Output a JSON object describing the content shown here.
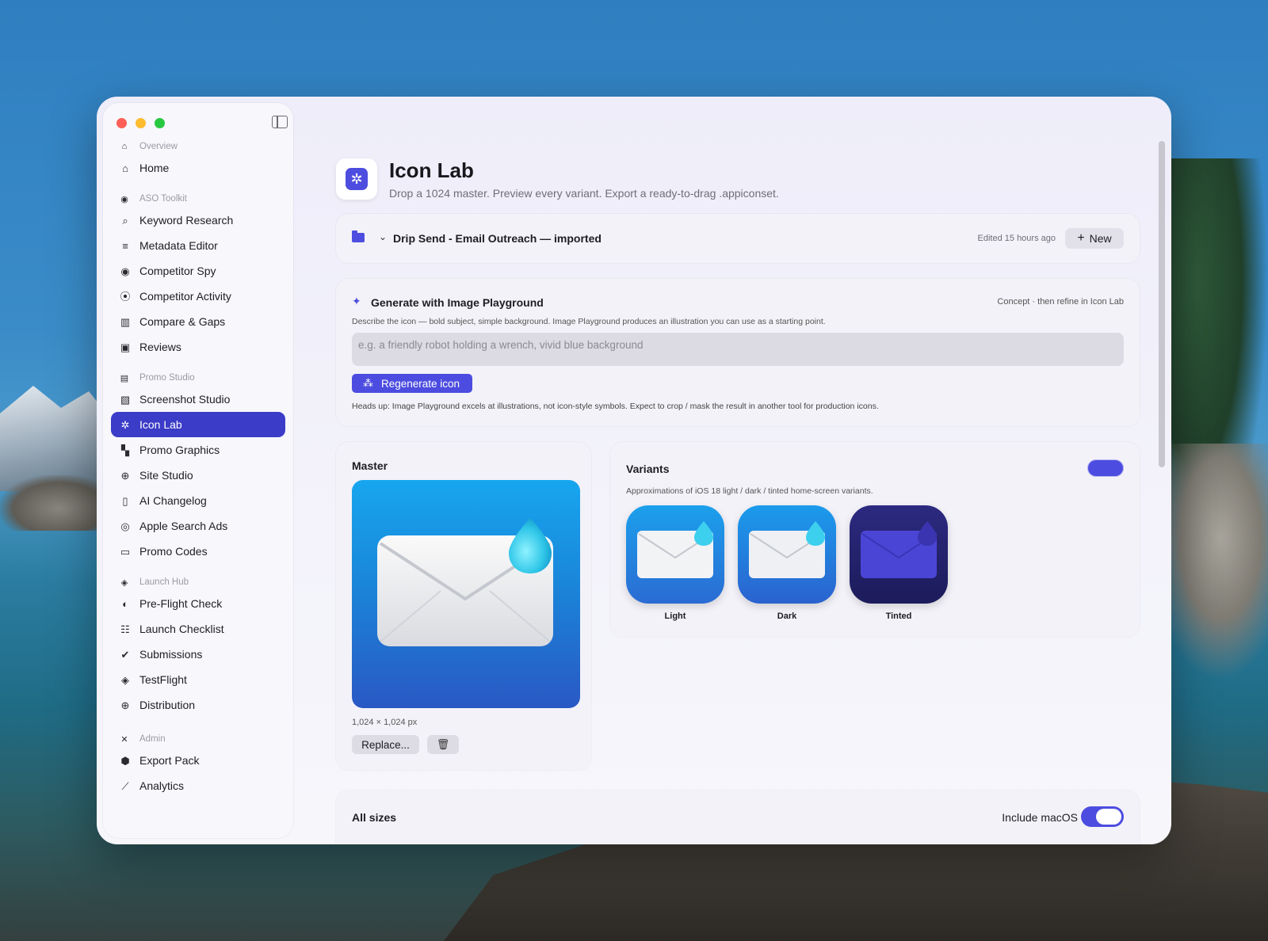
{
  "sidebar": {
    "sections": [
      {
        "header": "Overview",
        "header_icon": "house-icon",
        "items": [
          {
            "label": "Home",
            "icon": "house-icon"
          }
        ]
      },
      {
        "header": "ASO Toolkit",
        "header_icon": "magnifier-icon",
        "items": [
          {
            "label": "Keyword Research",
            "icon": "magnifier-icon"
          },
          {
            "label": "Metadata Editor",
            "icon": "text-lines-icon"
          },
          {
            "label": "Competitor Spy",
            "icon": "eye-icon"
          },
          {
            "label": "Competitor Activity",
            "icon": "broadcast-icon"
          },
          {
            "label": "Compare & Gaps",
            "icon": "columns-icon"
          },
          {
            "label": "Reviews",
            "icon": "speech-bubbles-icon"
          }
        ]
      },
      {
        "header": "Promo Studio",
        "header_icon": "bag-icon",
        "items": [
          {
            "label": "Screenshot Studio",
            "icon": "photo-icon"
          },
          {
            "label": "Icon Lab",
            "icon": "app-icon"
          },
          {
            "label": "Promo Graphics",
            "icon": "layout-icon"
          },
          {
            "label": "Site Studio",
            "icon": "globe-icon"
          },
          {
            "label": "AI Changelog",
            "icon": "document-icon"
          },
          {
            "label": "Apple Search Ads",
            "icon": "magnifier-circle-icon"
          },
          {
            "label": "Promo Codes",
            "icon": "ticket-icon"
          }
        ]
      },
      {
        "header": "Launch Hub",
        "header_icon": "paperplane-icon",
        "items": [
          {
            "label": "Pre-Flight Check",
            "icon": "gauge-icon"
          },
          {
            "label": "Launch Checklist",
            "icon": "checklist-icon"
          },
          {
            "label": "Submissions",
            "icon": "checkmark-seal-icon"
          },
          {
            "label": "TestFlight",
            "icon": "paperplane-icon"
          },
          {
            "label": "Distribution",
            "icon": "globe-icon"
          }
        ]
      },
      {
        "header": "Admin",
        "header_icon": "tools-icon",
        "items": [
          {
            "label": "Export Pack",
            "icon": "cube-icon"
          },
          {
            "label": "Analytics",
            "icon": "chart-line-icon"
          }
        ]
      }
    ],
    "active_item": "Icon Lab"
  },
  "header": {
    "title": "Icon Lab",
    "subtitle": "Drop a 1024 master. Preview every variant. Export a ready-to-drag .appiconset."
  },
  "project": {
    "name": "Drip Send - Email Outreach — imported",
    "edited": "Edited 15 hours ago",
    "new_label": "New"
  },
  "generate": {
    "title": "Generate with Image Playground",
    "tag": "Concept · then refine in Icon Lab",
    "description": "Describe the icon — bold subject, simple background. Image Playground produces an illustration you can use as a starting point.",
    "placeholder": "e.g. a friendly robot holding a wrench, vivid blue background",
    "button_label": "Regenerate icon",
    "note": "Heads up: Image Playground excels at illustrations, not icon-style symbols. Expect to crop / mask the result in another tool for production icons."
  },
  "master": {
    "title": "Master",
    "dimensions": "1,024 × 1,024 px",
    "replace_label": "Replace..."
  },
  "variants": {
    "title": "Variants",
    "description": "Approximations of iOS 18 light / dark / tinted home-screen variants.",
    "items": [
      {
        "label": "Light"
      },
      {
        "label": "Dark"
      },
      {
        "label": "Tinted"
      }
    ]
  },
  "sizes": {
    "title": "All sizes",
    "include_macos_label": "Include macOS",
    "include_macos": true
  },
  "colors": {
    "accent": "#4c4ce0",
    "sidebar_active": "#3b3cc7"
  }
}
